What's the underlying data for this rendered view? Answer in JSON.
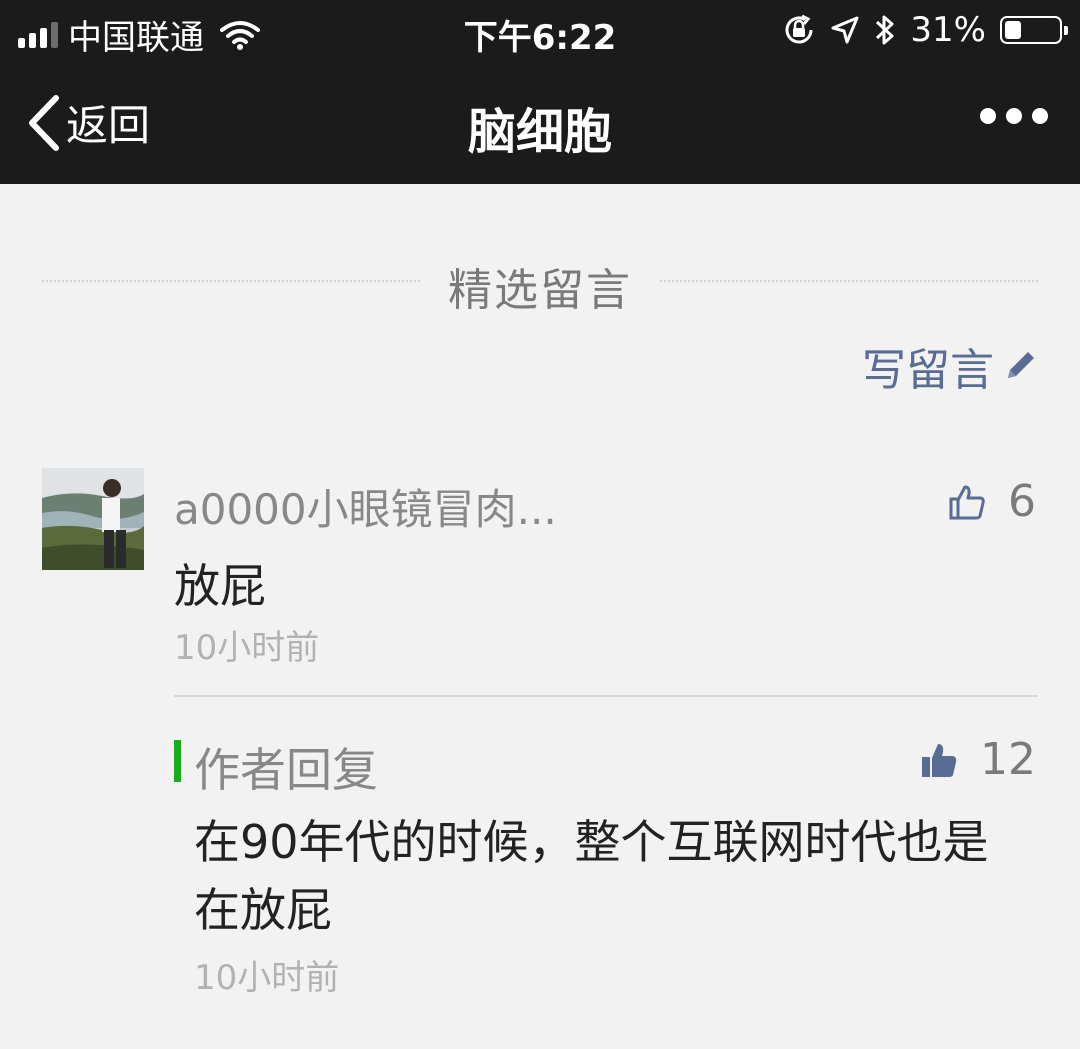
{
  "status_bar": {
    "carrier": "中国联通",
    "time": "下午6:22",
    "battery_percent": "31%",
    "battery_level": 0.31
  },
  "nav": {
    "back_label": "返回",
    "title": "脑细胞",
    "more_icon": "more-dots-icon"
  },
  "section": {
    "title": "精选留言",
    "write_label": "写留言"
  },
  "comment": {
    "username": "a0000小眼镜冒肉...",
    "text": "放屁",
    "time": "10小时前",
    "like_count": "6"
  },
  "reply": {
    "label": "作者回复",
    "text": "在90年代的时候，整个互联网时代也是在放屁",
    "time": "10小时前",
    "like_count": "12"
  },
  "colors": {
    "bar_background": "#1b1b1c",
    "page_background": "#f2f2f2",
    "link_blue": "#586c94",
    "reply_accent": "#1aad19"
  }
}
